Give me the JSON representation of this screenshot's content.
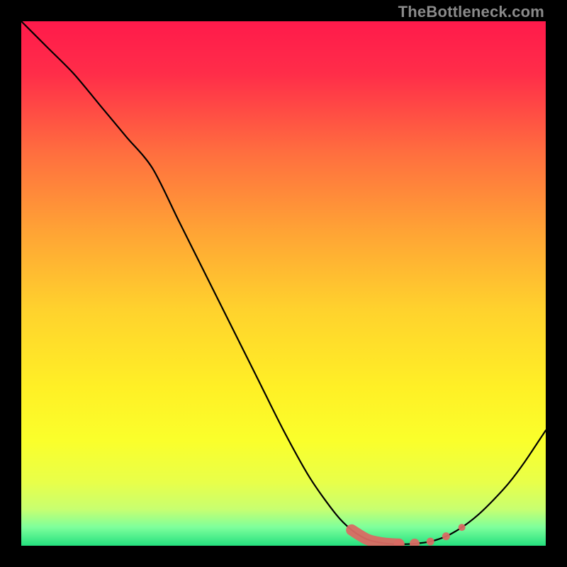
{
  "watermark": "TheBottleneck.com",
  "gradient": {
    "stops": [
      {
        "offset": 0.0,
        "color": "#ff1a4b"
      },
      {
        "offset": 0.1,
        "color": "#ff2d49"
      },
      {
        "offset": 0.25,
        "color": "#ff6e3f"
      },
      {
        "offset": 0.4,
        "color": "#ffa335"
      },
      {
        "offset": 0.55,
        "color": "#ffd22d"
      },
      {
        "offset": 0.7,
        "color": "#fff026"
      },
      {
        "offset": 0.8,
        "color": "#faff2b"
      },
      {
        "offset": 0.88,
        "color": "#e8ff4a"
      },
      {
        "offset": 0.93,
        "color": "#c8ff70"
      },
      {
        "offset": 0.965,
        "color": "#7dff9c"
      },
      {
        "offset": 1.0,
        "color": "#24e07e"
      }
    ]
  },
  "chart_data": {
    "type": "line",
    "title": "",
    "xlabel": "",
    "ylabel": "",
    "xlim": [
      0,
      100
    ],
    "ylim": [
      0,
      100
    ],
    "grid": false,
    "series": [
      {
        "name": "curve",
        "color": "#000000",
        "x": [
          0,
          5,
          10,
          15,
          20,
          25,
          30,
          35,
          40,
          45,
          50,
          55,
          60,
          63,
          66,
          69,
          72,
          75,
          78,
          81,
          84,
          87,
          90,
          93,
          96,
          100
        ],
        "y": [
          100,
          95,
          90,
          84,
          78,
          72,
          62,
          52,
          42,
          32,
          22,
          13,
          6,
          3,
          1.2,
          0.5,
          0.3,
          0.4,
          0.8,
          1.8,
          3.5,
          5.8,
          8.7,
          12,
          16,
          22
        ]
      }
    ],
    "highlight": {
      "name": "low-region",
      "color": "#d96a63",
      "x": [
        63,
        66,
        69,
        72,
        75,
        78,
        81,
        84
      ],
      "y": [
        3,
        1.2,
        0.5,
        0.3,
        0.4,
        0.8,
        1.8,
        3.5
      ]
    }
  }
}
